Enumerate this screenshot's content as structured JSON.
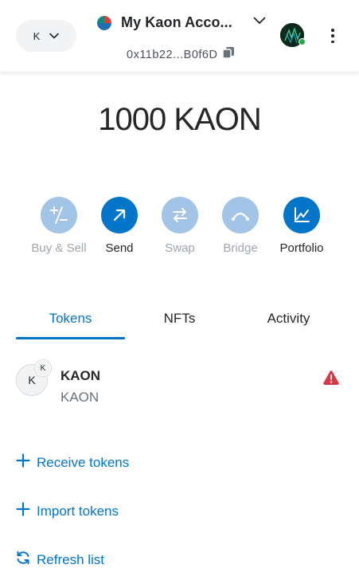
{
  "header": {
    "network_letter": "K",
    "account_name": "My Kaon Acco...",
    "address": "0x11b22...B0f6D"
  },
  "balance": "1000 KAON",
  "actions": [
    {
      "label": "Buy & Sell",
      "icon": "plus-minus-icon",
      "enabled": false
    },
    {
      "label": "Send",
      "icon": "arrow-up-right-icon",
      "enabled": true
    },
    {
      "label": "Swap",
      "icon": "swap-arrows-icon",
      "enabled": false
    },
    {
      "label": "Bridge",
      "icon": "bridge-icon",
      "enabled": false
    },
    {
      "label": "Portfolio",
      "icon": "chart-line-icon",
      "enabled": true
    }
  ],
  "tabs": [
    {
      "label": "Tokens",
      "active": true
    },
    {
      "label": "NFTs",
      "active": false
    },
    {
      "label": "Activity",
      "active": false
    }
  ],
  "tokens": [
    {
      "icon_letter": "K",
      "badge_letter": "K",
      "name": "KAON",
      "subtitle": "KAON",
      "warning": true
    }
  ],
  "links": {
    "receive": "Receive tokens",
    "import": "Import tokens",
    "refresh": "Refresh list"
  },
  "colors": {
    "primary": "#0376c9",
    "primary_disabled": "#a2c4e6",
    "warning": "#d73847",
    "text": "#24272a",
    "muted": "#6a737d"
  }
}
